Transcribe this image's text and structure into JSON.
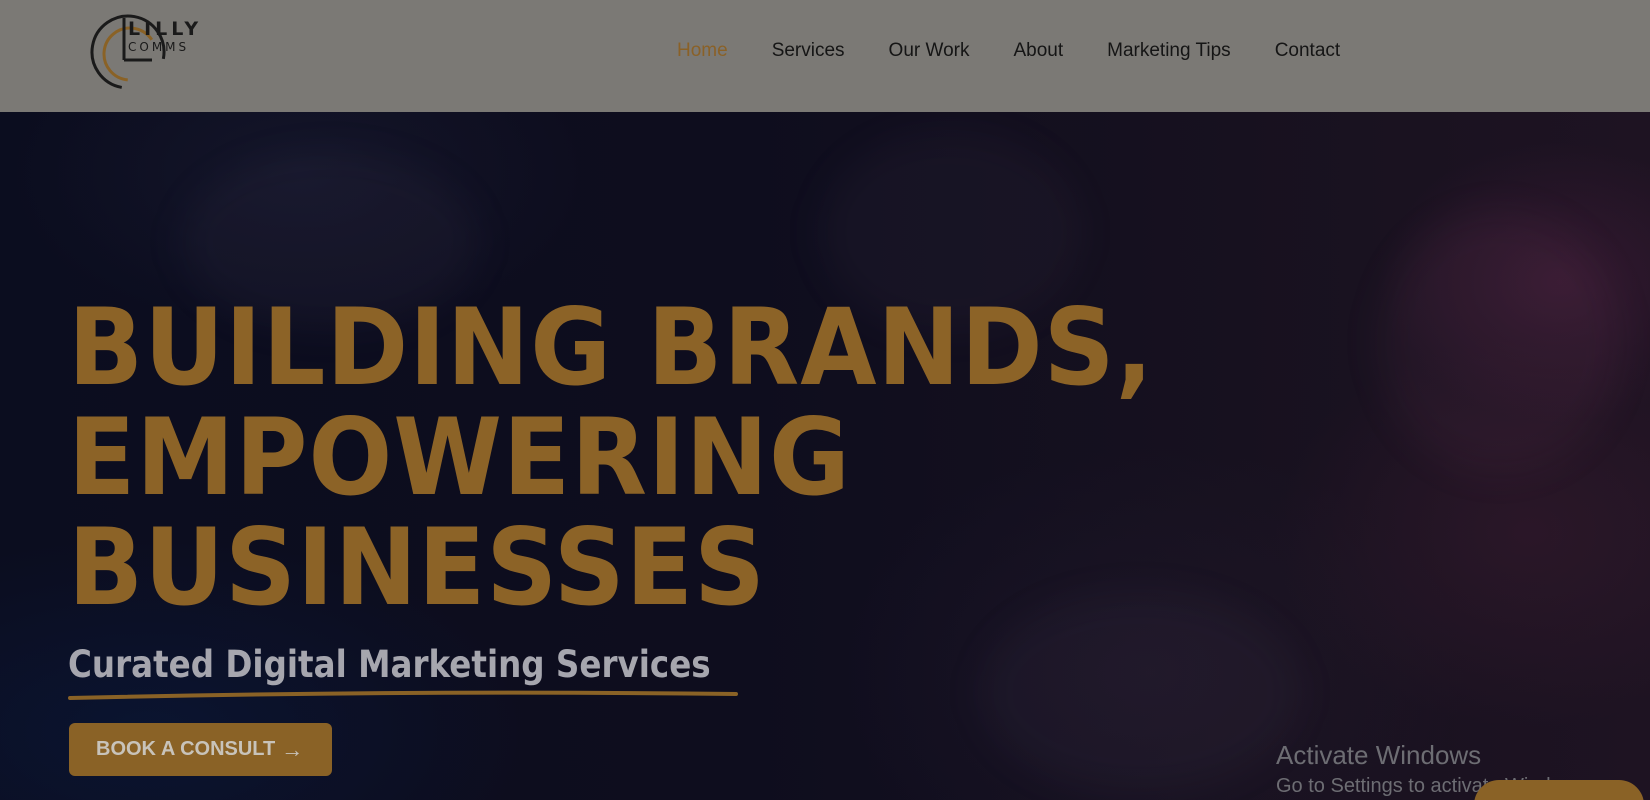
{
  "header": {
    "logo": {
      "line1": "LILLY",
      "line2": "COMMS",
      "icon": "lilly-comms-logo-mark"
    },
    "nav": {
      "items": [
        {
          "label": "Home",
          "active": true
        },
        {
          "label": "Services",
          "active": false
        },
        {
          "label": "Our Work",
          "active": false
        },
        {
          "label": "About",
          "active": false
        },
        {
          "label": "Marketing Tips",
          "active": false
        },
        {
          "label": "Contact",
          "active": false
        }
      ]
    }
  },
  "hero": {
    "headline": [
      "BUILDING BRANDS,",
      "EMPOWERING",
      "BUSINESSES"
    ],
    "subheading": "Curated Digital Marketing Services",
    "cta": {
      "label": "BOOK A CONSULT",
      "icon": "arrow-right-icon"
    }
  },
  "watermark": {
    "title": "Activate Windows",
    "subtitle": "Go to Settings to activate Windows."
  },
  "colors": {
    "header_bg": "#7b7975",
    "gold_accent": "#8c6327",
    "nav_active": "#8a6127",
    "hero_bg": "#0c0c1a"
  }
}
